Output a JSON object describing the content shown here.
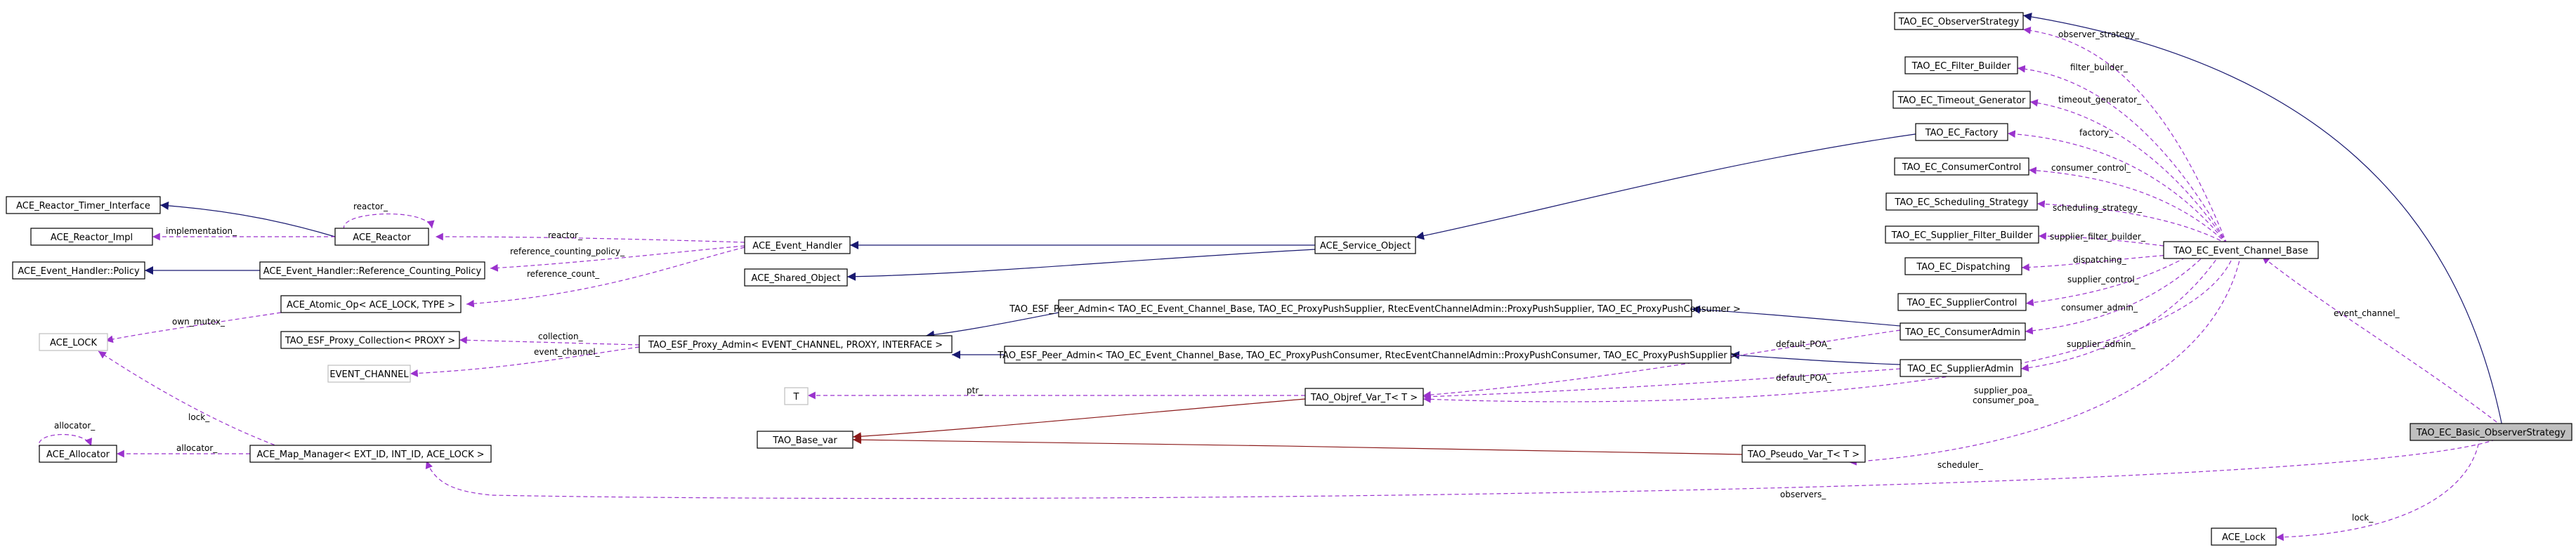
{
  "nodes": {
    "ace_reactor_timer_interface": "ACE_Reactor_Timer_Interface",
    "ace_reactor_impl": "ACE_Reactor_Impl",
    "ace_event_handler_policy": "ACE_Event_Handler::Policy",
    "ace_reactor": "ACE_Reactor",
    "ace_eh_ref_counting_policy": "ACE_Event_Handler::Reference_Counting_Policy",
    "ace_atomic_op": "ACE_Atomic_Op< ACE_LOCK, TYPE >",
    "ace_lock": "ACE_LOCK",
    "ace_allocator": "ACE_Allocator",
    "ace_map_manager": "ACE_Map_Manager< EXT_ID, INT_ID, ACE_LOCK >",
    "tao_esf_proxy_collection": "TAO_ESF_Proxy_Collection< PROXY >",
    "event_channel": "EVENT_CHANNEL",
    "ace_event_handler": "ACE_Event_Handler",
    "ace_shared_object": "ACE_Shared_Object",
    "tao_esf_proxy_admin": "TAO_ESF_Proxy_Admin< EVENT_CHANNEL, PROXY, INTERFACE >",
    "t": "T",
    "tao_base_var": "TAO_Base_var",
    "ace_service_object": "ACE_Service_Object",
    "tao_esf_peer_admin_consumer": "TAO_ESF_Peer_Admin< TAO_EC_Event_Channel_Base, TAO_EC_ProxyPushSupplier, RtecEventChannelAdmin::ProxyPushSupplier, TAO_EC_ProxyPushConsumer >",
    "tao_esf_peer_admin_supplier": "TAO_ESF_Peer_Admin< TAO_EC_Event_Channel_Base, TAO_EC_ProxyPushConsumer, RtecEventChannelAdmin::ProxyPushConsumer, TAO_EC_ProxyPushSupplier >",
    "tao_objref_var": "TAO_Objref_Var_T< T >",
    "tao_pseudo_var": "TAO_Pseudo_Var_T< T >",
    "tao_ec_observer_strategy": "TAO_EC_ObserverStrategy",
    "tao_ec_filter_builder": "TAO_EC_Filter_Builder",
    "tao_ec_timeout_generator": "TAO_EC_Timeout_Generator",
    "tao_ec_factory": "TAO_EC_Factory",
    "tao_ec_consumer_control": "TAO_EC_ConsumerControl",
    "tao_ec_scheduling_strategy": "TAO_EC_Scheduling_Strategy",
    "tao_ec_supplier_filter_builder": "TAO_EC_Supplier_Filter_Builder",
    "tao_ec_dispatching": "TAO_EC_Dispatching",
    "tao_ec_supplier_control": "TAO_EC_SupplierControl",
    "tao_ec_consumer_admin": "TAO_EC_ConsumerAdmin",
    "tao_ec_supplier_admin": "TAO_EC_SupplierAdmin",
    "tao_ec_event_channel_base": "TAO_EC_Event_Channel_Base",
    "tao_ec_basic_observer_strategy": "TAO_EC_Basic_ObserverStrategy",
    "ace_lock_class": "ACE_Lock"
  },
  "edge_labels": {
    "reactor_self": "reactor_",
    "implementation": "implementation_",
    "reactor": "reactor_",
    "reference_counting_policy": "reference_counting_policy_",
    "reference_count": "reference_count_",
    "own_mutex": "own_mutex_",
    "lock_map": "lock_",
    "allocator_self": "allocator_",
    "allocator": "allocator_",
    "collection": "collection_",
    "event_channel_esf": "event_channel_",
    "ptr": "ptr_",
    "default_poa_1": "default_POA_",
    "default_poa_2": "default_POA_",
    "observer_strategy": "observer_strategy_",
    "filter_builder": "filter_builder_",
    "timeout_generator": "timeout_generator_",
    "factory": "factory_",
    "consumer_control": "consumer_control_",
    "scheduling_strategy": "scheduling_strategy_",
    "supplier_filter_builder": "supplier_filter_builder_",
    "dispatching": "dispatching_",
    "supplier_control": "supplier_control_",
    "consumer_admin": "consumer_admin_",
    "supplier_admin": "supplier_admin_",
    "supplier_poa": "supplier_poa_",
    "consumer_poa": "consumer_poa_",
    "scheduler": "scheduler_",
    "event_channel_main": "event_channel_",
    "observers": "observers_",
    "lock_main": "lock_"
  },
  "colors": {
    "inheritance": "#191970",
    "template_instantiation": "#8b1a1a",
    "usage": "#9a32cd",
    "focus_fill": "#bfbfbf"
  }
}
